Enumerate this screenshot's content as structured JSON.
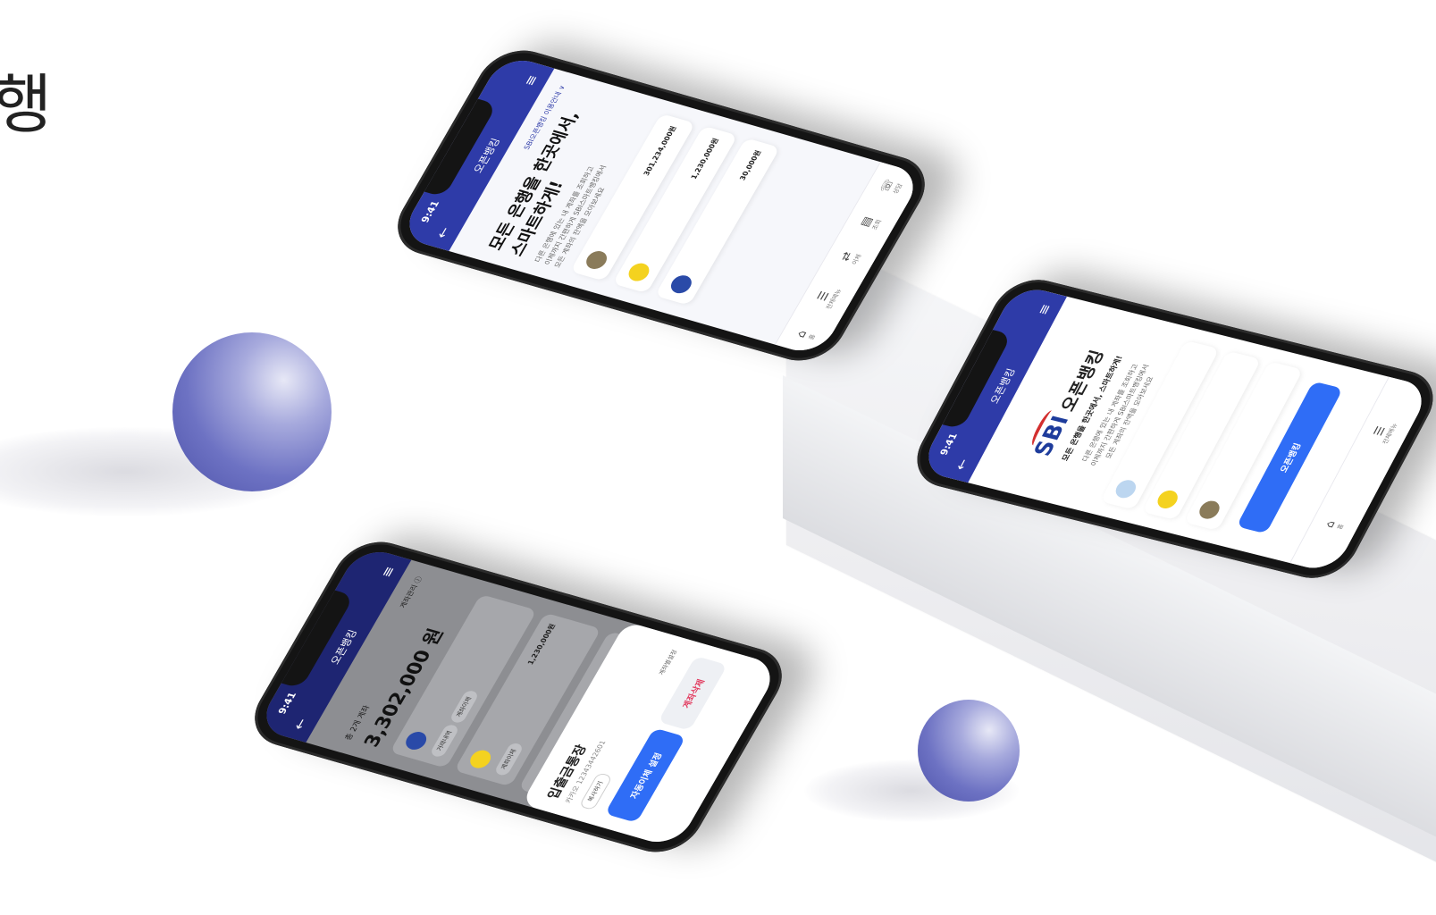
{
  "page": {
    "heading": "행"
  },
  "phone1": {
    "time": "9:41",
    "title": "오픈뱅킹",
    "guide_link": "SBI오픈뱅킹 이용안내 ∨",
    "headline_line1": "모든 은행을 한곳에서,",
    "headline_line2": "스마트하게!",
    "desc_line1": "다른 은행에 있는 내 계좌를 조회하고",
    "desc_line2": "이체까지 간편하게 SBI스마트뱅킹에서",
    "desc_line3": "모든 계좌의 잔액을 모아보세요",
    "cards": [
      {
        "amount": "301,234,000원"
      },
      {
        "amount": "1,230,000원"
      },
      {
        "amount": "30,000원"
      }
    ],
    "tabs": [
      "홈",
      "전체메뉴",
      "이체",
      "조회",
      "상담"
    ]
  },
  "phone2": {
    "time": "9:41",
    "title": "오픈뱅킹",
    "logo_text": "SBI",
    "logo_tag": "오픈뱅킹",
    "tagline": "모든 은행을 한곳에서, 스마트하게!",
    "desc_line1": "다른 은행에 있는 내 계좌를 조회하고",
    "desc_line2": "이체까지 간편하게 SBI스마트뱅킹에서",
    "desc_line3": "모든 계좌의 잔액을 모아보세요",
    "cta": "오픈뱅킹",
    "tabs": [
      "홈",
      "전체메뉴"
    ]
  },
  "phone3": {
    "time": "9:41",
    "title": "오픈뱅킹",
    "manage_link": "계좌관리 ⓘ",
    "total_label": "총 2개 계좌",
    "total_amount": "3,302,000 원",
    "account_pills": [
      "거래내역",
      "계좌이체"
    ],
    "amounts": [
      "1,230,000원",
      "1,230,000원"
    ],
    "transfer_label": "계좌이체",
    "sheet_title": "입출금통장",
    "sheet_sub": "카카오 12343442601",
    "copy_button": "복사하기",
    "auto_button": "자동이체 설정",
    "delete_button": "계좌삭제",
    "settings_link": "계좌별설정"
  },
  "colors": {
    "brand_navy": "#2e3ba8",
    "primary_blue": "#2f6df6",
    "danger": "#e23b5f",
    "sphere": "#6d72c3"
  }
}
